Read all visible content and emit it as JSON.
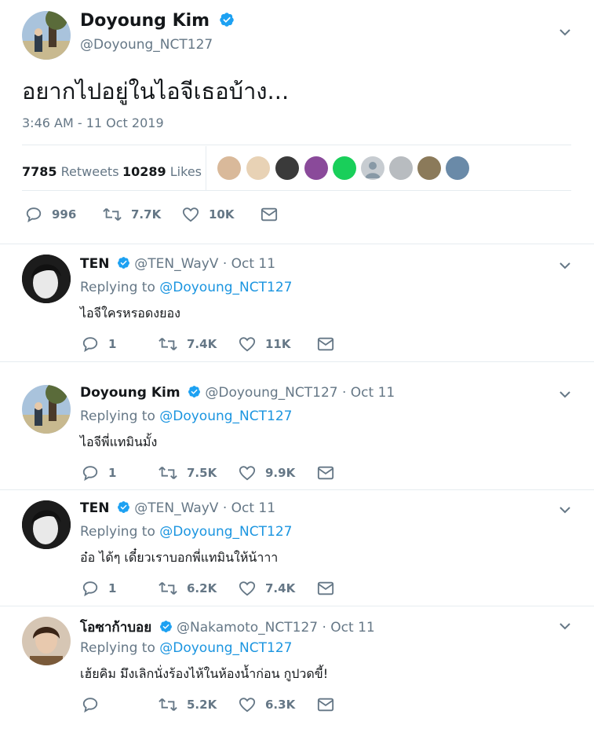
{
  "main_tweet": {
    "author_name": "Doyoung Kim",
    "handle": "@Doyoung_NCT127",
    "text": "อยากไปอยู่ในไอจีเธอบ้าง...",
    "timestamp": "3:46 AM - 11 Oct 2019",
    "retweets_count": "7785",
    "retweets_label": "Retweets",
    "likes_count": "10289",
    "likes_label": "Likes",
    "reply_count": "996",
    "retweet_short": "7.7K",
    "like_short": "10K"
  },
  "replies": [
    {
      "author_name": "TEN",
      "handle_date": "@TEN_WayV · Oct 11",
      "replying_prefix": "Replying to",
      "replying_handle": "@Doyoung_NCT127",
      "text": "ไอจีใครหรอดงยอง",
      "reply_count": "1",
      "retweet_count": "7.4K",
      "like_count": "11K"
    },
    {
      "author_name": "Doyoung Kim",
      "handle_date": "@Doyoung_NCT127 · Oct 11",
      "replying_prefix": "Replying to",
      "replying_handle": "@Doyoung_NCT127",
      "text": "ไอจีพี่แทมินมั้ง",
      "reply_count": "1",
      "retweet_count": "7.5K",
      "like_count": "9.9K"
    },
    {
      "author_name": "TEN",
      "handle_date": "@TEN_WayV · Oct 11",
      "replying_prefix": "Replying to",
      "replying_handle": "@Doyoung_NCT127",
      "text": "อ๋อ ได้ๆ เดี๋ยวเราบอกพี่แทมินให้น้าาา",
      "reply_count": "1",
      "retweet_count": "6.2K",
      "like_count": "7.4K"
    },
    {
      "author_name": "โอซาก้าบอย",
      "handle_date": "@Nakamoto_NCT127 · Oct 11",
      "replying_prefix": "Replying to",
      "replying_handle": "@Doyoung_NCT127",
      "text": "เฮ้ยคิม มึงเลิกนั่งร้องไห้ในห้องน้ำก่อน กูปวดขี้!",
      "reply_count": "",
      "retweet_count": "5.2K",
      "like_count": "6.3K"
    }
  ],
  "colors": {
    "accent": "#1b95e0",
    "muted": "#657786",
    "divider": "#e6ecf0",
    "verified": "#1da1f2"
  },
  "icons": [
    "verified-badge-icon",
    "chevron-down-icon",
    "reply-icon",
    "retweet-icon",
    "like-icon",
    "message-icon"
  ]
}
